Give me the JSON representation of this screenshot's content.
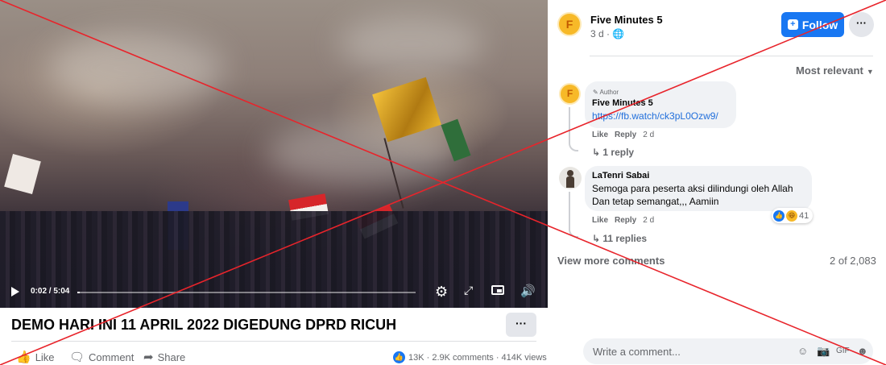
{
  "video": {
    "time": "0:02 / 5:04",
    "progress": 0.007,
    "title": "DEMO HARI INI 11 APRIL 2022 DIGEDUNG DPRD RICUH",
    "more": "···"
  },
  "actions": {
    "like": "Like",
    "comment": "Comment",
    "share": "Share",
    "stats": "13K · 2.9K comments · 414K views"
  },
  "post": {
    "avatar_letter": "F",
    "page_name": "Five Minutes 5",
    "meta": "3 d · ",
    "follow": "Follow",
    "more": "···",
    "sort": "Most relevant"
  },
  "comments": [
    {
      "avatar": "F",
      "badge": "Author",
      "name": "Five Minutes 5",
      "link": "https://fb.watch/ck3pL0Ozw9/",
      "like": "Like",
      "reply": "Reply",
      "age": "2 d",
      "replies": "1 reply"
    },
    {
      "name": "LaTenri Sabai",
      "text_line1": "Semoga para peserta aksi dilindungi oleh Allah",
      "text_line2": "Dan tetap semangat,,, Aamiin",
      "reaction_count": "41",
      "like": "Like",
      "reply": "Reply",
      "age": "2 d",
      "replies": "11 replies"
    }
  ],
  "footer": {
    "view_more": "View more comments",
    "count": "2 of 2,083",
    "write_placeholder": "Write a comment..."
  },
  "colors": {
    "accent": "#1877f2",
    "cross": "#e8242b"
  }
}
